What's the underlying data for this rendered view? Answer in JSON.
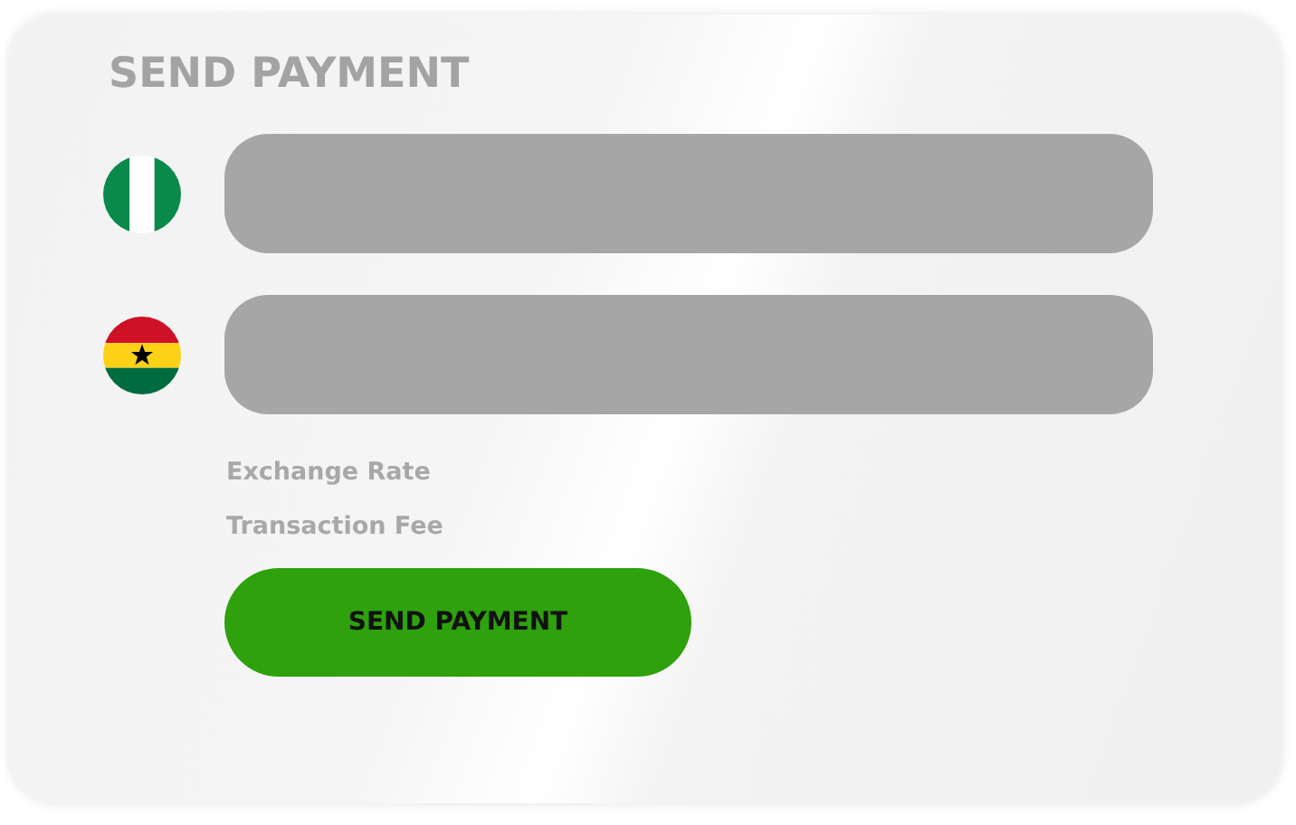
{
  "title": "SEND PAYMENT",
  "fields": [
    {
      "kind": "nigeria"
    },
    {
      "kind": "ghana"
    }
  ],
  "info": [
    "Exchange Rate",
    "Transaction Fee"
  ],
  "button": "SEND PAYMENT"
}
